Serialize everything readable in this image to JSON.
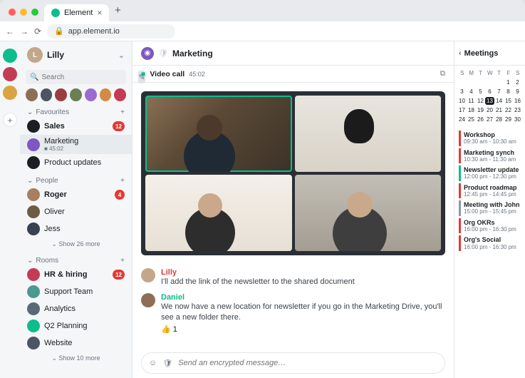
{
  "browser": {
    "tab_title": "Element",
    "url": "app.element.io"
  },
  "user": {
    "name": "Lilly",
    "color": "#c2a78a"
  },
  "search": {
    "placeholder": "Search"
  },
  "direct_avatars": [
    {
      "color": "#8e6f55"
    },
    {
      "color": "#4b5563"
    },
    {
      "color": "#9a3f3f"
    },
    {
      "color": "#6b7f56"
    },
    {
      "color": "#9c6bd1"
    },
    {
      "color": "#d48a46"
    },
    {
      "color": "#c43b56"
    }
  ],
  "sections": {
    "favourites": {
      "label": "Favourites",
      "show_more": "",
      "items": [
        {
          "icon_color": "#1b1f23",
          "label": "Sales",
          "badge": "12",
          "bold": true
        },
        {
          "icon_color": "#7e57c2",
          "label": "Marketing",
          "subtitle": "45:02",
          "selected": true,
          "video": true
        },
        {
          "icon_color": "#1b1f23",
          "label": "Product updates"
        }
      ]
    },
    "people": {
      "label": "People",
      "show_more": "Show 26 more",
      "items": [
        {
          "icon_color": "#a7815d",
          "label": "Roger",
          "badge": "4",
          "bold": true
        },
        {
          "icon_color": "#6b5c43",
          "label": "Oliver"
        },
        {
          "icon_color": "#374151",
          "label": "Jess"
        }
      ]
    },
    "rooms": {
      "label": "Rooms",
      "show_more": "Show 10 more",
      "items": [
        {
          "icon_color": "#c43b56",
          "label": "HR & hiring",
          "badge": "12",
          "bold": true
        },
        {
          "icon_color": "#4a9b8e",
          "label": "Support Team"
        },
        {
          "icon_color": "#5a6978",
          "label": "Analytics"
        },
        {
          "icon_color": "#0dbd8b",
          "label": "Q2 Planning"
        },
        {
          "icon_color": "#4b5563",
          "label": "Website"
        }
      ]
    }
  },
  "servers": [
    {
      "color": "#0dbd8b",
      "glyph": ""
    },
    {
      "color": "#c43b56",
      "glyph": ""
    },
    {
      "color": "#d9a441",
      "glyph": ""
    }
  ],
  "room": {
    "name": "Marketing",
    "pinned_label": "Video call",
    "pinned_duration": "45:02"
  },
  "messages": [
    {
      "author": "Lilly",
      "author_color": "#e53935",
      "avatar_color": "#c2a78a",
      "text": "I'll add the link of the newsletter to the shared document"
    },
    {
      "author": "Daniel",
      "author_color": "#0dbd8b",
      "avatar_color": "#8e6f55",
      "text": "We now have a new location for newsletter if you go in the Marketing Drive, you'll see a new folder there.",
      "reaction": "👍 1"
    }
  ],
  "composer": {
    "placeholder": "Send an encrypted message…"
  },
  "meetings": {
    "title": "Meetings",
    "days": [
      "S",
      "M",
      "T",
      "W",
      "T",
      "F",
      "S"
    ],
    "weeks": [
      [
        "",
        "",
        "",
        "",
        "",
        "1",
        "2"
      ],
      [
        "3",
        "4",
        "5",
        "6",
        "7",
        "8",
        "9"
      ],
      [
        "10",
        "11",
        "12",
        "13",
        "14",
        "15",
        "16"
      ],
      [
        "17",
        "18",
        "19",
        "20",
        "21",
        "22",
        "23"
      ],
      [
        "24",
        "25",
        "26",
        "27",
        "28",
        "29",
        "30"
      ]
    ],
    "today": "13",
    "events": [
      {
        "title": "Workshop",
        "time": "09:30 am - 10:30 am",
        "cls": ""
      },
      {
        "title": "Marketing synch",
        "time": "10:30 am - 11:30 am",
        "cls": ""
      },
      {
        "title": "Newsletter update",
        "time": "12:00 pm - 12:30 pm",
        "cls": "green"
      },
      {
        "title": "Product roadmap",
        "time": "12:45 pm - 14:45 pm",
        "cls": ""
      },
      {
        "title": "Meeting with John",
        "time": "15:00 pm - 15:45 pm",
        "cls": "gray"
      },
      {
        "title": "Org OKRs",
        "time": "16:00 pm - 16:30 pm",
        "cls": ""
      },
      {
        "title": "Org's Social",
        "time": "16:00 pm - 16:30 pm",
        "cls": ""
      }
    ]
  }
}
